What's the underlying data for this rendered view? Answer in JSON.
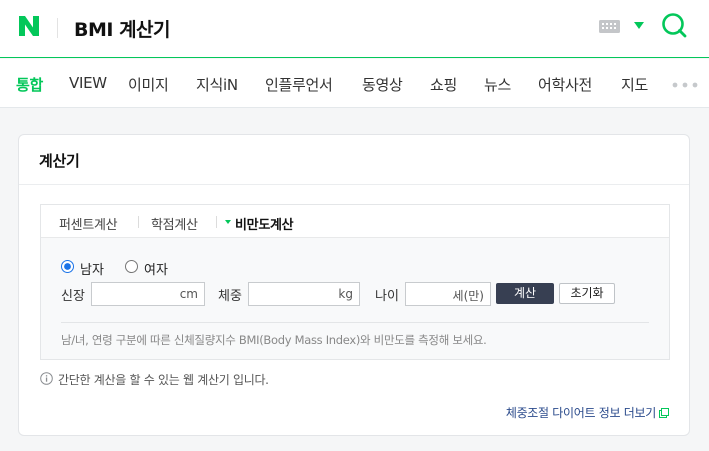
{
  "header": {
    "logo_text": "N",
    "query": "BMI 계산기"
  },
  "nav": {
    "tabs": [
      "통합",
      "VIEW",
      "이미지",
      "지식iN",
      "인플루언서",
      "동영상",
      "쇼핑",
      "뉴스",
      "어학사전",
      "지도"
    ],
    "active_tab": "통합"
  },
  "card": {
    "title": "계산기",
    "calc_tabs": [
      "퍼센트계산",
      "학점계산",
      "비만도계산"
    ],
    "active_calc_tab": "비만도계산",
    "gender_options": [
      "남자",
      "여자"
    ],
    "gender_selected": "남자",
    "height_label": "신장",
    "height_unit": "cm",
    "height_value": "",
    "weight_label": "체중",
    "weight_unit": "kg",
    "weight_value": "",
    "age_label": "나이",
    "age_unit": "세(만)",
    "age_value": "",
    "calc_button": "계산",
    "reset_button": "초기화",
    "description": "남/녀, 연령 구분에 따른 신체질량지수 BMI(Body Mass Index)와 비만도를 측정해 보세요."
  },
  "info_text": "간단한 계산을 할 수 있는 웹 계산기 입니다.",
  "more_link": "체중조절 다이어트 정보 더보기",
  "colors": {
    "brand_green": "#03c75a",
    "calc_button_bg": "#373f52",
    "link_blue": "#2b4b8c"
  }
}
